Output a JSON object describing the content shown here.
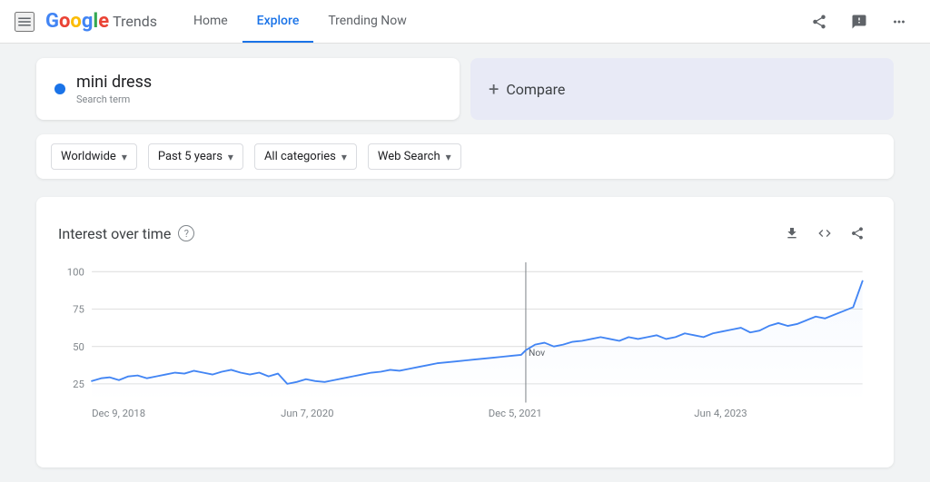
{
  "header": {
    "logo": {
      "google": "Google",
      "trends": "Trends"
    },
    "nav": [
      {
        "id": "home",
        "label": "Home",
        "active": false
      },
      {
        "id": "explore",
        "label": "Explore",
        "active": true
      },
      {
        "id": "trending",
        "label": "Trending Now",
        "active": false
      }
    ],
    "hamburger_label": "☰",
    "icons": {
      "share": "share-icon",
      "feedback": "feedback-icon",
      "apps": "apps-icon"
    }
  },
  "search": {
    "term": {
      "text": "mini dress",
      "sub": "Search term",
      "dot_color": "#1a73e8"
    },
    "compare": {
      "label": "Compare",
      "plus": "+"
    }
  },
  "filters": [
    {
      "id": "region",
      "label": "Worldwide",
      "selected": "Worldwide"
    },
    {
      "id": "time",
      "label": "Past 5 years",
      "selected": "Past 5 years"
    },
    {
      "id": "category",
      "label": "All categories",
      "selected": "All categories"
    },
    {
      "id": "search_type",
      "label": "Web Search",
      "selected": "Web Search"
    }
  ],
  "chart": {
    "title": "Interest over time",
    "help_label": "?",
    "y_labels": [
      "100",
      "75",
      "50",
      "25"
    ],
    "x_labels": [
      "Dec 9, 2018",
      "Jun 7, 2020",
      "Dec 5, 2021",
      "Jun 4, 2023"
    ],
    "vertical_line_label": "Nov",
    "actions": {
      "download": "⬇",
      "embed": "<>",
      "share": "share"
    }
  }
}
